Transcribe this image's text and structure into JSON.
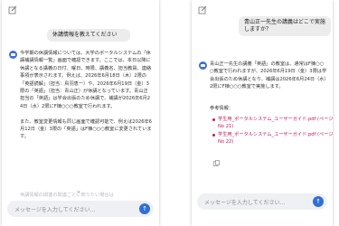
{
  "left": {
    "question": "休講情報を教えてください",
    "answer": "今学期の休講情報については、大学のポータルシステムの「休講補講情報一覧」画面で確認できます。ここでは、本日以降に休講となる講義の日付、曜日、時限、講義名、担当教員、連絡事項が表示されます。例えば、2026年6月18日（木）2限の「英語読解」（担当：鳥羽恵一）や、2026年6月19日（金）3限の「英語」（担当：青山正）が休講となっています。青山正担当の「英語」は学会出張のため休講で、補講が2026年6月24日（水）2限にF棟○○○教室で行われます。\n\nまた、教室変更情報も同じ画面で確認可能で、例えば2026年6月12日（金）3限の「英語」はF棟○○○教室に変更されています。",
    "faded_line": "休講情報の関連の関連ごとに知りたい場合は",
    "input_placeholder": "メッセージを入力してください..."
  },
  "right": {
    "question": "青山正一先生の講義はどこで実施しますか？",
    "answer": "青山正一先生の講義「英語」の教室は、通常はF棟○○○教室で行われますが、2026年6月19日（金）3限は学会出張のため休講となり、補講は2026年6月24日（水）2限にF棟○○○教室で実施します。",
    "refs_title": "参考情報：",
    "refs": [
      "学生用_ポータルシステム_ユーザーガイド.pdf (ページNo 21)",
      "学生用_ポータルシステム_ユーザーガイド.pdf (ページNo 22)"
    ],
    "input_placeholder": "メッセージを入力してください..."
  },
  "icons": {
    "edit": "edit-icon",
    "bot": "bot-avatar-icon",
    "copy": "copy-icon",
    "send": "send-icon",
    "scroll_down": "chevron-down-icon"
  },
  "colors": {
    "accent": "#2f6fd6",
    "reference_link": "#c2185b",
    "user_bubble": "#ececec"
  }
}
